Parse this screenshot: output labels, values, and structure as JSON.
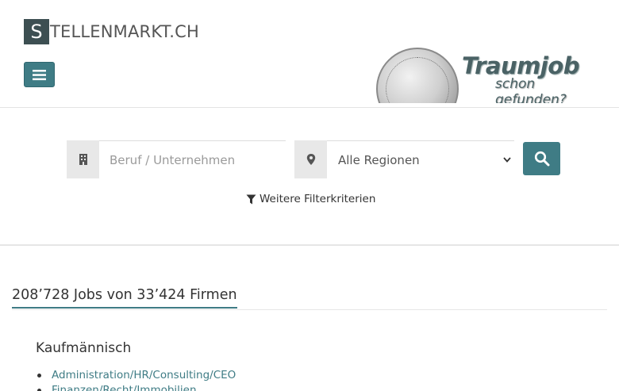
{
  "header": {
    "logo_letter": "S",
    "logo_text": "TELLENMARKT.CH",
    "banner_title": "Traumjob",
    "banner_subtitle": "schon gefunden?"
  },
  "search": {
    "keyword_placeholder": "Beruf / Unternehmen",
    "region_value": "Alle Regionen",
    "filter_label": "Weitere Filterkriterien"
  },
  "stats": {
    "summary": "208’728 Jobs von 33’424 Firmen"
  },
  "category": {
    "title": "Kaufmännisch",
    "items": [
      "Administration/HR/Consulting/CEO",
      "Finanzen/Recht/Immobilien"
    ]
  },
  "colors": {
    "accent": "#3f7c85",
    "logo_box": "#3d4f52"
  },
  "icons": [
    "bars-icon",
    "building-icon",
    "map-marker-icon",
    "search-icon",
    "filter-icon",
    "chevron-down-icon"
  ]
}
